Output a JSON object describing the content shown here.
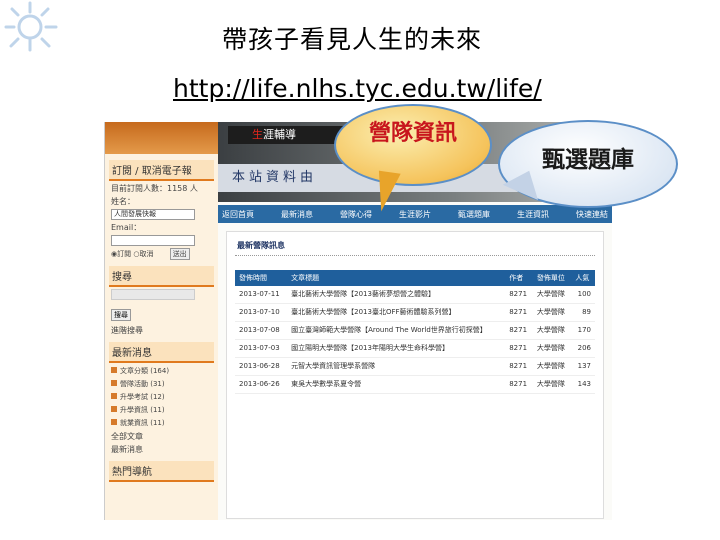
{
  "slide": {
    "title": "帶孩子看見人生的未來",
    "url": "http://life.nlhs.tyc.edu.tw/life/"
  },
  "callouts": {
    "left": "營隊資訊",
    "right": "甄選題庫"
  },
  "site": {
    "logo": {
      "accent": "生",
      "rest": "涯輔導"
    },
    "banner_text": "本站資料由",
    "sidebar": {
      "subscribe_header": "訂閱 / 取消電子報",
      "subscriber_count": "目前訂閱人數：1158 人",
      "name_label": "姓名：",
      "name_value": "人間發展快報",
      "email_label": "Email：",
      "radio_subscribe": "訂閱",
      "radio_cancel": "取消",
      "send_button": "送出",
      "search_header": "搜尋",
      "search_button": "搜尋",
      "advanced_search": "進階搜尋",
      "category_header": "最新消息",
      "categories": [
        "文章分類 (164)",
        "營隊活動 (31)",
        "升學考試 (12)",
        "升學資訊 (11)",
        "就業資訊 (11)"
      ],
      "all_articles": "全部文章",
      "latest_link": "最新消息",
      "hot_header": "熱門導航"
    },
    "nav": [
      "返回首頁",
      "最新消息",
      "營隊心得",
      "生涯影片",
      "甄選題庫",
      "生涯資訊",
      "快速連結"
    ],
    "content_title": "最新營隊訊息",
    "table": {
      "headers": [
        "發佈時間",
        "文章標題",
        "作者",
        "發佈單位",
        "人氣"
      ],
      "rows": [
        {
          "date": "2013-07-11",
          "title": "臺北藝術大學營隊【2013藝術夢想營之體驗】",
          "author": "8271",
          "unit": "大學營隊",
          "views": "100"
        },
        {
          "date": "2013-07-10",
          "title": "臺北藝術大學營隊【2013臺北OFF藝術體驗系列營】",
          "author": "8271",
          "unit": "大學營隊",
          "views": "89"
        },
        {
          "date": "2013-07-08",
          "title": "國立臺灣師範大學營隊【Around The World世界旅行初探營】",
          "author": "8271",
          "unit": "大學營隊",
          "views": "170"
        },
        {
          "date": "2013-07-03",
          "title": "國立陽明大學營隊【2013年陽明大學生命科學營】",
          "author": "8271",
          "unit": "大學營隊",
          "views": "206"
        },
        {
          "date": "2013-06-28",
          "title": "元智大學資訊管理學系營隊",
          "author": "8271",
          "unit": "大學營隊",
          "views": "137"
        },
        {
          "date": "2013-06-26",
          "title": "東吳大學數學系夏令營",
          "author": "8271",
          "unit": "大學營隊",
          "views": "143"
        }
      ]
    }
  },
  "colors": {
    "nav_blue": "#2a6aa3",
    "sidebar_orange": "#e07a1e",
    "callout_red_text": "#c8161d"
  }
}
